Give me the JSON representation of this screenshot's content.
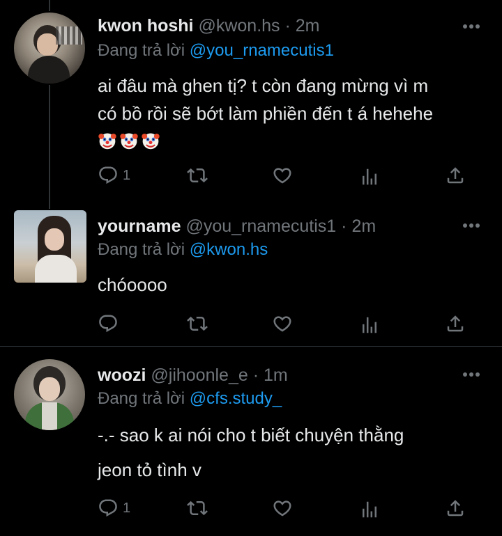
{
  "tweets": [
    {
      "display_name": "kwon hoshi",
      "handle": "@kwon.hs",
      "separator": "·",
      "time": "2m",
      "reply_prefix": "Đang trả lời",
      "reply_to": "@you_rnamecutis1",
      "text_line1": "ai đâu mà ghen tị? t còn đang mừng vì m",
      "text_line2": "có bồ rồi sẽ bớt làm phiền đến t á hehehe",
      "emoji": [
        "clown-face",
        "clown-face",
        "clown-face"
      ],
      "reply_count": "1"
    },
    {
      "display_name": "yourname",
      "handle": "@you_rnamecutis1",
      "separator": "·",
      "time": "2m",
      "reply_prefix": "Đang trả lời",
      "reply_to": "@kwon.hs",
      "text_line1": "chóoooo",
      "reply_count": ""
    },
    {
      "display_name": "woozi",
      "handle": "@jihoonle_e",
      "separator": "·",
      "time": "1m",
      "reply_prefix": "Đang trả lời",
      "reply_to": "@cfs.study_",
      "text_line1": "-.- sao k ai nói cho t biết chuyện thằng",
      "text_line2": "jeon tỏ tình v",
      "reply_count": "1"
    }
  ],
  "icons": [
    "more-icon",
    "reply-icon",
    "retweet-icon",
    "like-icon",
    "views-icon",
    "share-icon"
  ],
  "colors": {
    "background": "#000000",
    "text": "#e7e9ea",
    "muted": "#71767b",
    "link": "#1d9bf0",
    "divider": "#2f3336"
  }
}
